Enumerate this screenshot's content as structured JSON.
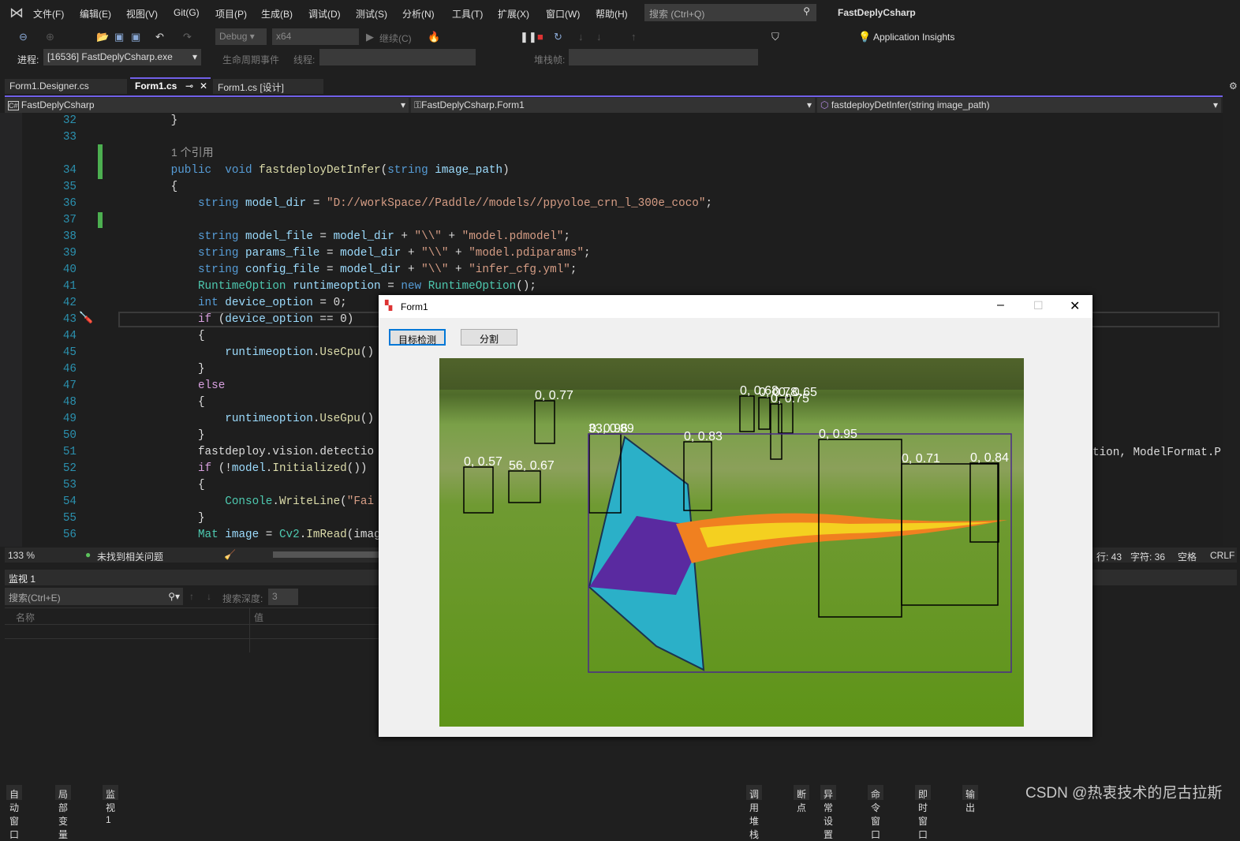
{
  "app": {
    "title": "FastDeplyCsharp",
    "search_placeholder": "搜索 (Ctrl+Q)"
  },
  "menu": [
    "文件(F)",
    "编辑(E)",
    "视图(V)",
    "Git(G)",
    "项目(P)",
    "生成(B)",
    "调试(D)",
    "测试(S)",
    "分析(N)",
    "工具(T)",
    "扩展(X)",
    "窗口(W)",
    "帮助(H)"
  ],
  "toolbar": {
    "config": "Debug",
    "platform": "x64",
    "continue": "继续(C)",
    "app_insights": "Application Insights",
    "process_label": "进程:",
    "process": "[16536] FastDeplyCsharp.exe",
    "lifecycle": "生命周期事件",
    "thread_label": "线程:",
    "stack_label": "堆栈帧:"
  },
  "tabs": [
    {
      "label": "Form1.Designer.cs"
    },
    {
      "label": "Form1.cs",
      "active": true
    },
    {
      "label": "Form1.cs [设计]"
    }
  ],
  "navbar": {
    "project": "FastDeplyCsharp",
    "class": "FastDeplyCsharp.Form1",
    "member": "fastdeployDetInfer(string image_path)"
  },
  "code": {
    "ref_hint": "1 个引用",
    "lines": [
      {
        "n": "32",
        "s": [
          [
            "pl",
            "        }"
          ]
        ]
      },
      {
        "n": "33",
        "s": []
      },
      {
        "n": "34",
        "s": [
          [
            "kw",
            "        public  void "
          ],
          [
            "fn",
            "fastdeployDetInfer"
          ],
          [
            "pl",
            "("
          ],
          [
            "kw",
            "string "
          ],
          [
            "id",
            "image_path"
          ],
          [
            "pl",
            ")"
          ]
        ]
      },
      {
        "n": "35",
        "s": [
          [
            "pl",
            "        {"
          ]
        ]
      },
      {
        "n": "36",
        "s": [
          [
            "kw",
            "            string "
          ],
          [
            "id",
            "model_dir"
          ],
          [
            "pl",
            " = "
          ],
          [
            "st",
            "\"D://workSpace//Paddle//models//ppyoloe_crn_l_300e_coco\""
          ],
          [
            "pl",
            ";"
          ]
        ]
      },
      {
        "n": "37",
        "s": []
      },
      {
        "n": "38",
        "s": [
          [
            "kw",
            "            string "
          ],
          [
            "id",
            "model_file"
          ],
          [
            "pl",
            " = "
          ],
          [
            "id",
            "model_dir"
          ],
          [
            "pl",
            " + "
          ],
          [
            "st",
            "\"\\\\\""
          ],
          [
            "pl",
            " + "
          ],
          [
            "st",
            "\"model.pdmodel\""
          ],
          [
            "pl",
            ";"
          ]
        ]
      },
      {
        "n": "39",
        "s": [
          [
            "kw",
            "            string "
          ],
          [
            "id",
            "params_file"
          ],
          [
            "pl",
            " = "
          ],
          [
            "id",
            "model_dir"
          ],
          [
            "pl",
            " + "
          ],
          [
            "st",
            "\"\\\\\""
          ],
          [
            "pl",
            " + "
          ],
          [
            "st",
            "\"model.pdiparams\""
          ],
          [
            "pl",
            ";"
          ]
        ]
      },
      {
        "n": "40",
        "s": [
          [
            "kw",
            "            string "
          ],
          [
            "id",
            "config_file"
          ],
          [
            "pl",
            " = "
          ],
          [
            "id",
            "model_dir"
          ],
          [
            "pl",
            " + "
          ],
          [
            "st",
            "\"\\\\\""
          ],
          [
            "pl",
            " + "
          ],
          [
            "st",
            "\"infer_cfg.yml\""
          ],
          [
            "pl",
            ";"
          ]
        ]
      },
      {
        "n": "41",
        "s": [
          [
            "ty",
            "            RuntimeOption "
          ],
          [
            "id",
            "runtimeoption"
          ],
          [
            "pl",
            " = "
          ],
          [
            "kw",
            "new "
          ],
          [
            "ty",
            "RuntimeOption"
          ],
          [
            "pl",
            "();"
          ]
        ]
      },
      {
        "n": "42",
        "s": [
          [
            "kw",
            "            int "
          ],
          [
            "id",
            "device_option"
          ],
          [
            "pl",
            " = 0;"
          ]
        ]
      },
      {
        "n": "43",
        "s": [
          [
            "ct",
            "            if "
          ],
          [
            "pl",
            "("
          ],
          [
            "id",
            "device_option"
          ],
          [
            "pl",
            " == 0)"
          ]
        ]
      },
      {
        "n": "44",
        "s": [
          [
            "pl",
            "            {"
          ]
        ]
      },
      {
        "n": "45",
        "s": [
          [
            "id",
            "                runtimeoption"
          ],
          [
            "pl",
            "."
          ],
          [
            "fn",
            "UseCpu"
          ],
          [
            "pl",
            "()"
          ]
        ]
      },
      {
        "n": "46",
        "s": [
          [
            "pl",
            "            }"
          ]
        ]
      },
      {
        "n": "47",
        "s": [
          [
            "ct",
            "            else"
          ]
        ]
      },
      {
        "n": "48",
        "s": [
          [
            "pl",
            "            {"
          ]
        ]
      },
      {
        "n": "49",
        "s": [
          [
            "id",
            "                runtimeoption"
          ],
          [
            "pl",
            "."
          ],
          [
            "fn",
            "UseGpu"
          ],
          [
            "pl",
            "()"
          ]
        ]
      },
      {
        "n": "50",
        "s": [
          [
            "pl",
            "            }"
          ]
        ]
      },
      {
        "n": "51",
        "s": [
          [
            "pl",
            "            fastdeploy.vision.detectio"
          ]
        ]
      },
      {
        "n": "52",
        "s": [
          [
            "ct",
            "            if "
          ],
          [
            "pl",
            "(!"
          ],
          [
            "id",
            "model"
          ],
          [
            "pl",
            "."
          ],
          [
            "fn",
            "Initialized"
          ],
          [
            "pl",
            "())"
          ]
        ]
      },
      {
        "n": "53",
        "s": [
          [
            "pl",
            "            {"
          ]
        ]
      },
      {
        "n": "54",
        "s": [
          [
            "ty",
            "                Console"
          ],
          [
            "pl",
            "."
          ],
          [
            "fn",
            "WriteLine"
          ],
          [
            "pl",
            "("
          ],
          [
            "st",
            "\"Fai"
          ]
        ]
      },
      {
        "n": "55",
        "s": [
          [
            "pl",
            "            }"
          ]
        ]
      },
      {
        "n": "56",
        "s": [
          [
            "ty",
            "            Mat "
          ],
          [
            "id",
            "image"
          ],
          [
            "pl",
            " = "
          ],
          [
            "ty",
            "Cv2"
          ],
          [
            "pl",
            "."
          ],
          [
            "fn",
            "ImRead"
          ],
          [
            "pl",
            "(imag"
          ]
        ]
      }
    ],
    "line51_tail": "tion, ModelFormat.P"
  },
  "status": {
    "zoom": "133 %",
    "issues": "未找到相关问题",
    "row": "行: 43",
    "col": "字符: 36",
    "indent": "空格",
    "eol": "CRLF"
  },
  "watch": {
    "title": "监视 1",
    "search_placeholder": "搜索(Ctrl+E)",
    "depth_label": "搜索深度:",
    "depth": "3",
    "col_name": "名称",
    "col_value": "值"
  },
  "bottom_tabs_left": [
    "自动窗口",
    "局部变量",
    "监视 1"
  ],
  "bottom_tabs_right": [
    "调用堆栈",
    "断点",
    "异常设置",
    "命令窗口",
    "即时窗口",
    "输出"
  ],
  "form": {
    "title": "Form1",
    "btn_detect": "目标检测",
    "btn_segment": "分割"
  },
  "detections": [
    {
      "label": "0, 0.77",
      "color": "#000000"
    },
    {
      "label": "0, 0.68",
      "color": "#000000"
    },
    {
      "label": "0, 0.78",
      "color": "#000000"
    },
    {
      "label": "0, 0.65",
      "color": "#000000"
    },
    {
      "label": "0, 0.75",
      "color": "#000000"
    },
    {
      "label": "0, 0.96",
      "color": "#000000"
    },
    {
      "label": "33, 0.89",
      "color": "#4b2a8a"
    },
    {
      "label": "0, 0.83",
      "color": "#000000"
    },
    {
      "label": "0, 0.95",
      "color": "#000000"
    },
    {
      "label": "0, 0.71",
      "color": "#000000"
    },
    {
      "label": "0, 0.84",
      "color": "#000000"
    },
    {
      "label": "0, 0.57",
      "color": "#000000"
    },
    {
      "label": "56, 0.67",
      "color": "#000000"
    }
  ],
  "watermark": "CSDN @热衷技术的尼古拉斯",
  "colors": {
    "accent": "#7160e8",
    "form_button_focus": "#0078d7"
  }
}
